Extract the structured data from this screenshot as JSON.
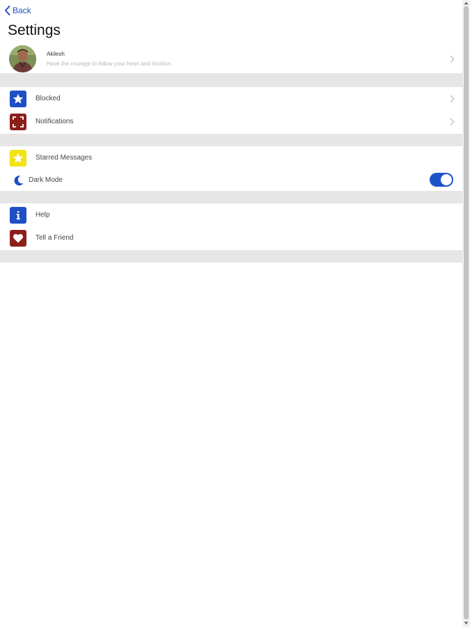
{
  "nav": {
    "back_label": "Back"
  },
  "page": {
    "title": "Settings"
  },
  "profile": {
    "name": "Akilesh",
    "status": "Have the courage to follow your heart and intuition"
  },
  "items": {
    "blocked": {
      "label": "Blocked",
      "icon": "star-icon",
      "color": "#1e4fc4"
    },
    "notifications": {
      "label": "Notifications",
      "icon": "focus-frame-icon",
      "color": "#8b1f1a"
    },
    "starred": {
      "label": "Starred Messages",
      "icon": "star-icon",
      "color": "#f2e313"
    },
    "dark_mode": {
      "label": "Dark Mode",
      "icon": "moon-icon",
      "enabled": true
    },
    "help": {
      "label": "Help",
      "icon": "info-icon",
      "color": "#1e4fc4"
    },
    "tell_friend": {
      "label": "Tell a Friend",
      "icon": "heart-icon",
      "color": "#8b1f1a"
    }
  },
  "colors": {
    "accent": "#1e53c6",
    "section_divider": "#e6e6e6",
    "scrollbar_thumb": "#c2c2c2"
  }
}
